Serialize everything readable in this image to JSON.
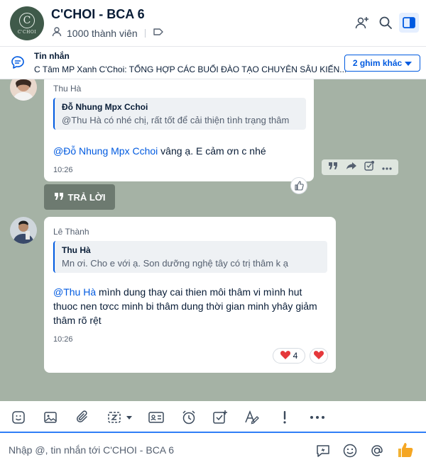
{
  "header": {
    "logo_mono": "C",
    "logo_word": "C'CHOI",
    "title": "C'CHOI - BCA 6",
    "members": "1000 thành viên"
  },
  "pinned": {
    "title": "Tin nhắn",
    "text": "C Tâm MP Xanh C'Choi: TỔNG HỢP CÁC BUỔI ĐÀO TẠO CHUYÊN SÂU KIẾN...",
    "more_label": "2 ghim khác"
  },
  "messages": [
    {
      "sender": "Thu Hà",
      "quote_name": "Đỗ Nhung Mpx Cchoi",
      "quote_text": "@Thu Hà có nhé chị, rất tốt để cải thiện tình trạng thâm",
      "mention": "@Đỗ Nhung Mpx Cchoi",
      "text": " vâng ạ. E cảm ơn c nhé",
      "time": "10:26"
    },
    {
      "sender": "Lê Thành",
      "quote_name": "Thu Hà",
      "quote_text": "Mn ơi. Cho e với ạ. Son dưỡng nghệ tây có trị thâm k ạ",
      "mention": "@Thu Hà",
      "text": " mình dung thay cai thien môi thâm vi mình hut thuoc nen tơcc minh bi thâm dung thời gian minh yhây giảm thâm rõ rệt",
      "time": "10:26",
      "reaction_count": "4"
    }
  ],
  "reply_label": "TRẢ LỜI",
  "composer": {
    "placeholder": "Nhập @, tin nhắn tới C'CHOI - BCA 6"
  },
  "colors": {
    "accent": "#005ae0",
    "chat_bg": "#a5b2a5",
    "heart": "#e5383b",
    "like": "#f5a623"
  }
}
